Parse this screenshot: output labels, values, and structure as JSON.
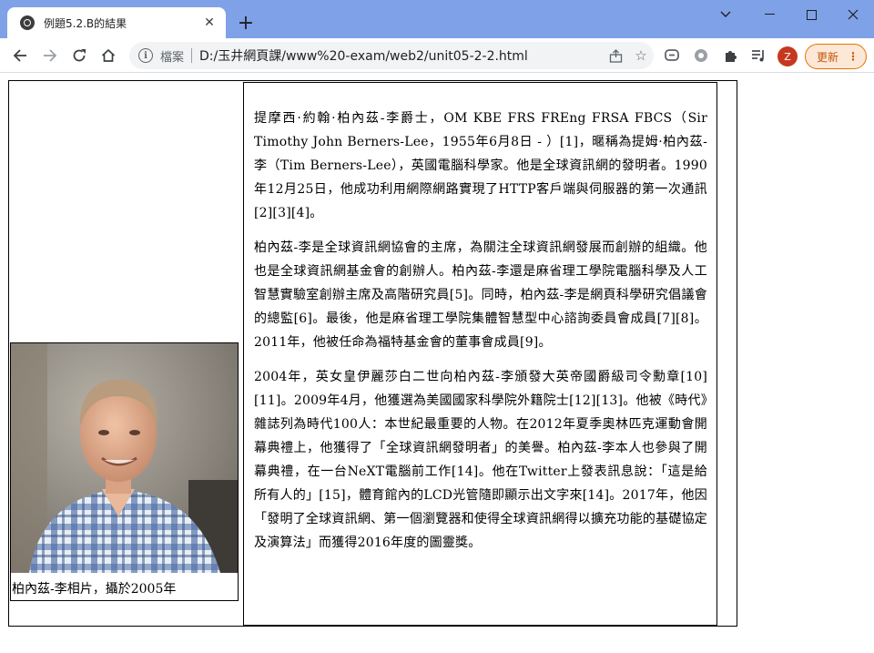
{
  "browser": {
    "tab_title": "例題5.2.B的結果",
    "address_scheme": "檔案",
    "address_url": "D:/玉井網頁課/www%20-exam/web2/unit05-2-2.html",
    "profile_initial": "Z",
    "update_label": "更新"
  },
  "icons": {
    "tab": "globe-icon",
    "back": "back-arrow-icon",
    "forward": "forward-arrow-icon",
    "reload": "reload-icon",
    "home": "home-icon",
    "info": "info-icon",
    "share": "share-icon",
    "bookmark": "star-icon",
    "ext1": "chat-extension-icon",
    "ext2": "gear-extension-icon",
    "extensions": "puzzle-icon",
    "media": "media-playlist-icon"
  },
  "figure": {
    "caption": "柏內茲-李相片，攝於2005年"
  },
  "article": {
    "p1": "提摩西·約翰·柏內茲-李爵士，OM KBE FRS FREng FRSA FBCS（Sir Timothy John Berners-Lee，1955年6月8日 - ）[1]，暱稱為提姆·柏內茲-李（Tim Berners-Lee），英國電腦科學家。他是全球資訊網的發明者。1990年12月25日，他成功利用網際網路實現了HTTP客戶端與伺服器的第一次通訊[2][3][4]。",
    "p2": "柏內茲-李是全球資訊網協會的主席，為關注全球資訊網發展而創辦的組織。他也是全球資訊網基金會的創辦人。柏內茲-李還是麻省理工學院電腦科學及人工智慧實驗室創辦主席及高階研究員[5]。同時，柏內茲-李是網頁科學研究倡議會的總監[6]。最後，他是麻省理工學院集體智慧型中心諮詢委員會成員[7][8]。2011年，他被任命為福特基金會的董事會成員[9]。",
    "p3": "2004年，英女皇伊麗莎白二世向柏內茲-李頒發大英帝國爵級司令勳章[10][11]。2009年4月，他獲選為美國國家科學院外籍院士[12][13]。他被《時代》雜誌列為時代100人：本世紀最重要的人物。在2012年夏季奧林匹克運動會開幕典禮上，他獲得了「全球資訊網發明者」的美譽。柏內茲-李本人也參與了開幕典禮，在一台NeXT電腦前工作[14]。他在Twitter上發表訊息說：「這是給所有人的」[15]，體育館內的LCD光管隨即顯示出文字來[14]。2017年，他因「發明了全球資訊網、第一個瀏覽器和使得全球資訊網得以擴充功能的基礎協定及演算法」而獲得2016年度的圖靈獎。"
  }
}
